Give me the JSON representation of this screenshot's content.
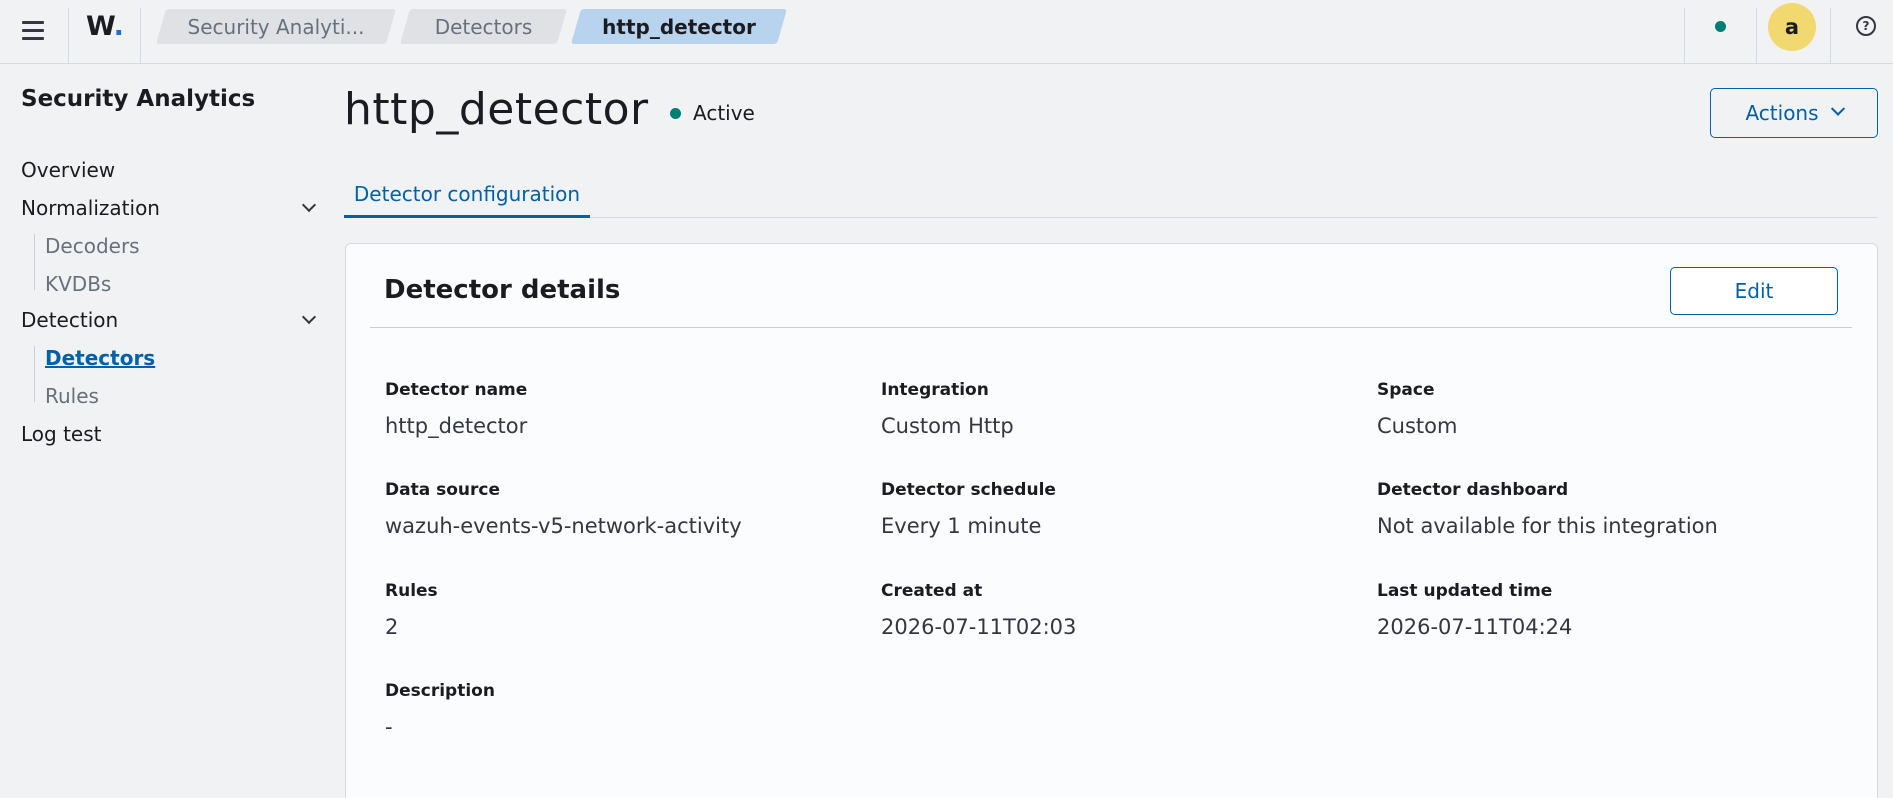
{
  "topbar": {
    "logo_text": "W",
    "logo_dot": ".",
    "breadcrumbs": [
      "Security Analyti...",
      "Detectors",
      "http_detector"
    ],
    "avatar_initial": "a",
    "help_glyph": "?",
    "status_color": "#017d73"
  },
  "sidebar": {
    "title": "Security Analytics",
    "items": {
      "overview": "Overview",
      "normalization": "Normalization",
      "decoders": "Decoders",
      "kvdbs": "KVDBs",
      "detection": "Detection",
      "detectors": "Detectors",
      "rules": "Rules",
      "log_test": "Log test"
    },
    "active_item": "Detectors"
  },
  "header": {
    "title": "http_detector",
    "status": "Active",
    "actions_label": "Actions"
  },
  "tabs": [
    {
      "label": "Detector configuration",
      "selected": true
    }
  ],
  "panel": {
    "title": "Detector details",
    "edit_label": "Edit",
    "fields": {
      "detector_name": {
        "label": "Detector name",
        "value": "http_detector"
      },
      "integration": {
        "label": "Integration",
        "value": "Custom Http"
      },
      "space": {
        "label": "Space",
        "value": "Custom"
      },
      "data_source": {
        "label": "Data source",
        "value": "wazuh-events-v5-network-activity"
      },
      "detector_schedule": {
        "label": "Detector schedule",
        "value": "Every 1 minute"
      },
      "detector_dashboard": {
        "label": "Detector dashboard",
        "value": "Not available for this integration"
      },
      "rules": {
        "label": "Rules",
        "value": "2"
      },
      "created_at": {
        "label": "Created at",
        "value": "2026-07-11T02:03"
      },
      "last_updated": {
        "label": "Last updated time",
        "value": "2026-07-11T04:24"
      },
      "description": {
        "label": "Description",
        "value": "-"
      }
    }
  },
  "colors": {
    "accent": "#0061a6",
    "active_status": "#017d73",
    "avatar_bg": "#f1d86f",
    "current_crumb_bg": "#b8d3ee"
  }
}
